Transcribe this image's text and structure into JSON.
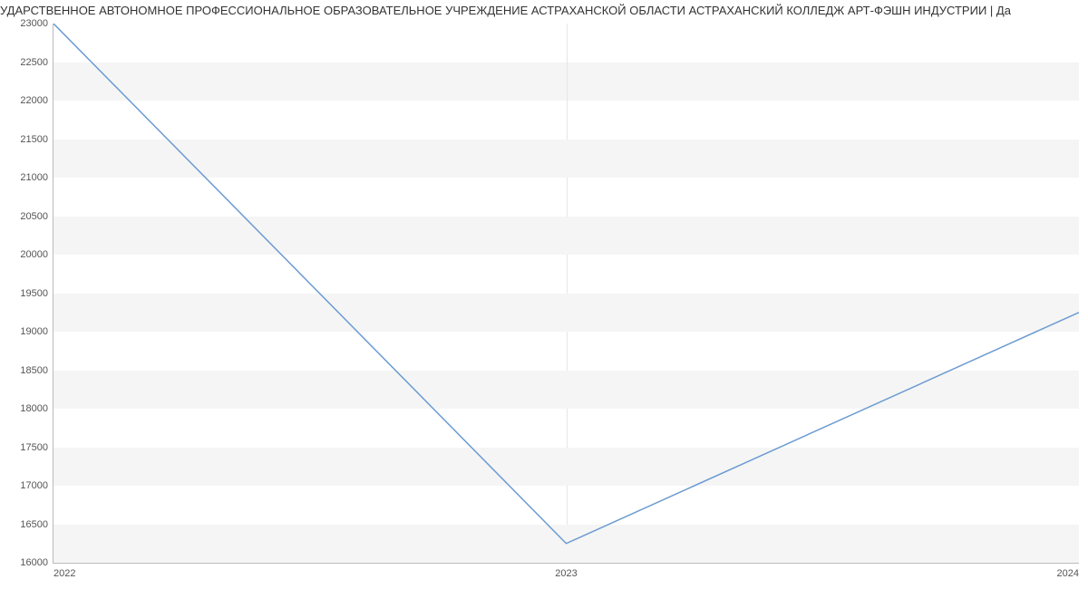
{
  "title": "УДАРСТВЕННОЕ АВТОНОМНОЕ ПРОФЕССИОНАЛЬНОЕ ОБРАЗОВАТЕЛЬНОЕ УЧРЕЖДЕНИЕ АСТРАХАНСКОЙ ОБЛАСТИ АСТРАХАНСКИЙ КОЛЛЕДЖ АРТ-ФЭШН ИНДУСТРИИ | Да",
  "chart_data": {
    "type": "line",
    "x": [
      2022,
      2023,
      2024
    ],
    "values": [
      23000,
      16250,
      19250
    ],
    "xlabel": "",
    "ylabel": "",
    "xlim": [
      2022,
      2024
    ],
    "ylim": [
      16000,
      23000
    ],
    "y_ticks": [
      16000,
      16500,
      17000,
      17500,
      18000,
      18500,
      19000,
      19500,
      20000,
      20500,
      21000,
      21500,
      22000,
      22500,
      23000
    ],
    "x_ticks": [
      2022,
      2023,
      2024
    ],
    "grid": true,
    "line_color": "#6b9bd1"
  }
}
